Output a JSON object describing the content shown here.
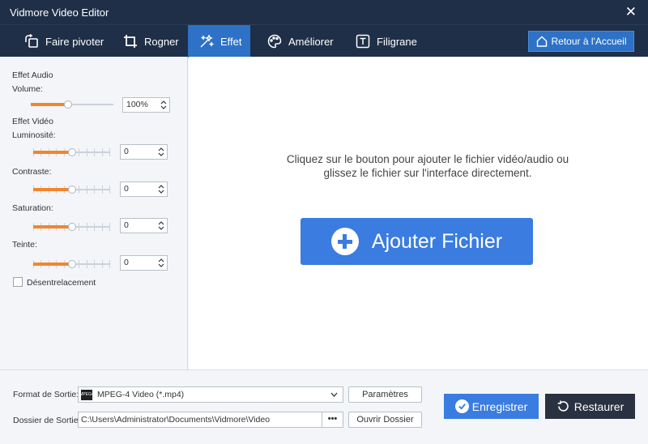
{
  "window": {
    "title": "Vidmore Video Editor"
  },
  "tabs": [
    {
      "label": "Faire pivoter",
      "icon": "rotate-icon"
    },
    {
      "label": "Rogner",
      "icon": "crop-icon"
    },
    {
      "label": "Effet",
      "icon": "magic-wand-icon",
      "active": true
    },
    {
      "label": "Améliorer",
      "icon": "palette-icon"
    },
    {
      "label": "Filigrane",
      "icon": "text-watermark-icon"
    }
  ],
  "home_button": "Retour à l'Accueil",
  "audio": {
    "section": "Effet Audio",
    "volume_label": "Volume:",
    "volume_value": "100%",
    "volume_level": 0.45
  },
  "video": {
    "section": "Effet Vidéo",
    "controls": [
      {
        "label": "Luminosité:",
        "value": "0",
        "level": 0.5
      },
      {
        "label": "Contraste:",
        "value": "0",
        "level": 0.5
      },
      {
        "label": "Saturation:",
        "value": "0",
        "level": 0.5
      },
      {
        "label": "Teinte:",
        "value": "0",
        "level": 0.5
      }
    ]
  },
  "deinterlace_label": "Désentrelacement",
  "dropzone": {
    "message": "Cliquez sur le bouton pour ajouter le fichier vidéo/audio ou glissez le fichier sur l'interface directement.",
    "add_button": "Ajouter Fichier"
  },
  "output": {
    "format_label": "Format de Sortie:",
    "format_value": "MPEG-4 Video (*.mp4)",
    "format_badge": "MPEG4",
    "params_button": "Paramètres",
    "folder_label": "Dossier de Sortie:",
    "folder_value": "C:\\Users\\Administrator\\Documents\\Vidmore\\Video",
    "browse_button": "•••",
    "open_folder_button": "Ouvrir Dossier"
  },
  "actions": {
    "save": "Enregistrer",
    "restore": "Restaurer"
  },
  "colors": {
    "titlebar": "#1f2f48",
    "accent": "#2d72c6",
    "slider_fill": "#f2862c",
    "restore_bg": "#2a3140"
  }
}
